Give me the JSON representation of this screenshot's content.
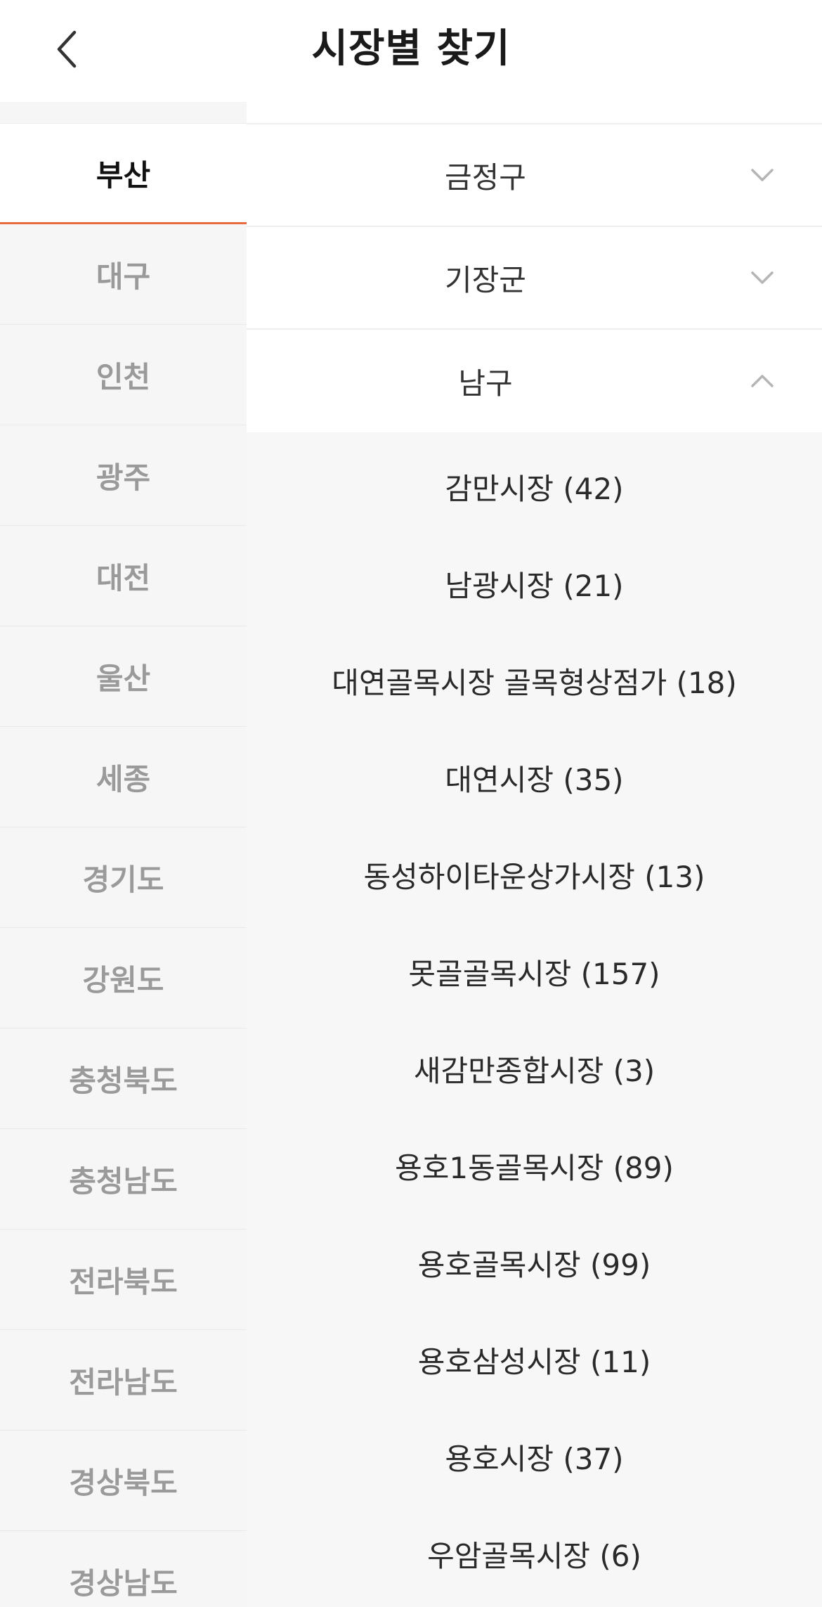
{
  "header": {
    "title": "시장별 찾기"
  },
  "sidebar": {
    "items": [
      {
        "label": "부산",
        "active": true
      },
      {
        "label": "대구",
        "active": false
      },
      {
        "label": "인천",
        "active": false
      },
      {
        "label": "광주",
        "active": false
      },
      {
        "label": "대전",
        "active": false
      },
      {
        "label": "울산",
        "active": false
      },
      {
        "label": "세종",
        "active": false
      },
      {
        "label": "경기도",
        "active": false
      },
      {
        "label": "강원도",
        "active": false
      },
      {
        "label": "충청북도",
        "active": false
      },
      {
        "label": "충청남도",
        "active": false
      },
      {
        "label": "전라북도",
        "active": false
      },
      {
        "label": "전라남도",
        "active": false
      },
      {
        "label": "경상북도",
        "active": false
      },
      {
        "label": "경상남도",
        "active": false
      }
    ]
  },
  "districts": [
    {
      "label": "금정구",
      "expanded": false,
      "icon": "chevron-down-icon"
    },
    {
      "label": "기장군",
      "expanded": false,
      "icon": "chevron-down-icon"
    },
    {
      "label": "남구",
      "expanded": true,
      "icon": "chevron-up-icon"
    }
  ],
  "markets": [
    {
      "label": "감만시장 (42)"
    },
    {
      "label": "남광시장 (21)"
    },
    {
      "label": "대연골목시장 골목형상점가 (18)"
    },
    {
      "label": "대연시장 (35)"
    },
    {
      "label": "동성하이타운상가시장 (13)"
    },
    {
      "label": "못골골목시장 (157)"
    },
    {
      "label": "새감만종합시장 (3)"
    },
    {
      "label": "용호1동골목시장 (89)"
    },
    {
      "label": "용호골목시장 (99)"
    },
    {
      "label": "용호삼성시장 (11)"
    },
    {
      "label": "용호시장 (37)"
    },
    {
      "label": "우암골목시장 (6)"
    }
  ],
  "colors": {
    "accent": "#ea6a3f",
    "sidebar_bg": "#f6f6f6",
    "inactive_text": "#9a9a9a"
  }
}
